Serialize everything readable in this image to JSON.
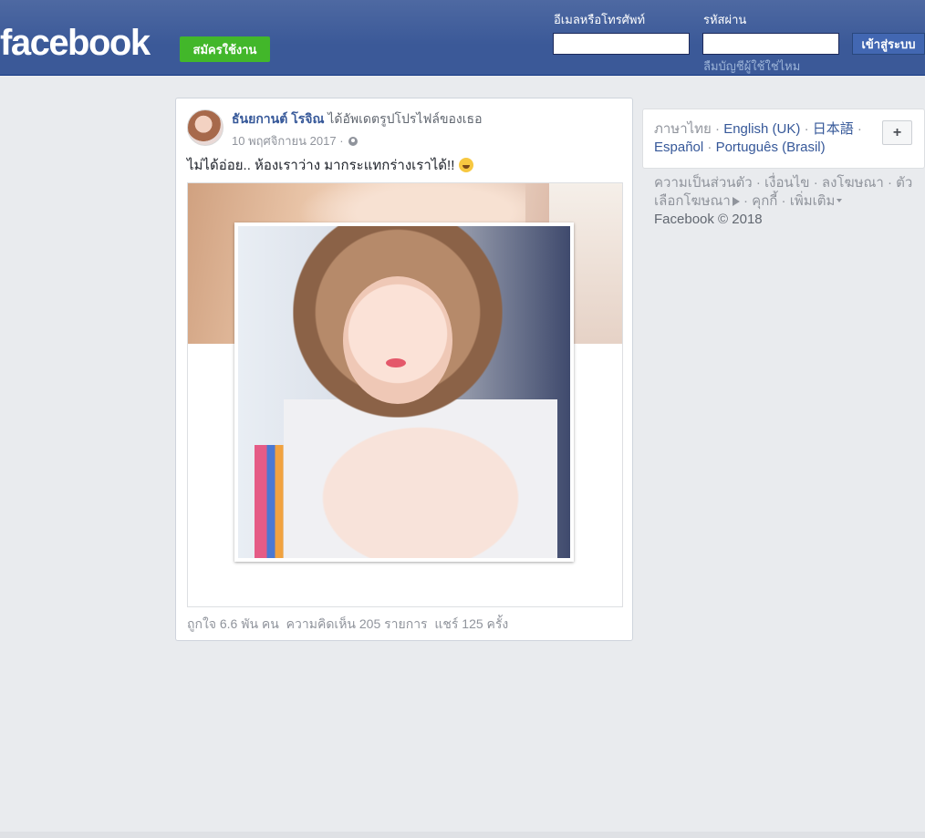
{
  "header": {
    "logo": "facebook",
    "signup_label": "สมัครใช้งาน",
    "email_label": "อีเมลหรือโทรศัพท์",
    "email_value": "",
    "password_label": "รหัสผ่าน",
    "password_value": "",
    "login_label": "เข้าสู่ระบบ",
    "forgot_label": "ลืมบัญชีผู้ใช้ใช่ไหม"
  },
  "post": {
    "author": "ธันยกานต์ โรจิณ",
    "action": "ได้อัพเดตรูปโปรไฟล์ของเธอ",
    "date": "10 พฤศจิกายน 2017",
    "meta_sep": "·",
    "privacy_icon": "globe-icon",
    "text": "ไม่ได้อ่อย.. ห้องเราว่าง มากระแทกร่างเราได้!!",
    "emoji_icon": "laughing-emoji-icon",
    "stats": {
      "likes": "ถูกใจ 6.6 พัน คน",
      "comments": "ความคิดเห็น 205 รายการ",
      "shares": "แชร์ 125 ครั้ง"
    }
  },
  "languages": {
    "current": "ภาษาไทย",
    "links": [
      "English (UK)",
      "日本語",
      "Español",
      "Português (Brasil)"
    ],
    "more_label": "+"
  },
  "footer": {
    "links": [
      "ความเป็นส่วนตัว",
      "เงื่อนไข",
      "ลงโฆษณา",
      "ตัวเลือกโฆษณา",
      "คุกกี้",
      "เพิ่มเติม"
    ],
    "copyright": "Facebook © 2018"
  },
  "colors": {
    "topbar": "#3b5998",
    "signup": "#42b72a",
    "link": "#365899",
    "background": "#e9ebee"
  }
}
